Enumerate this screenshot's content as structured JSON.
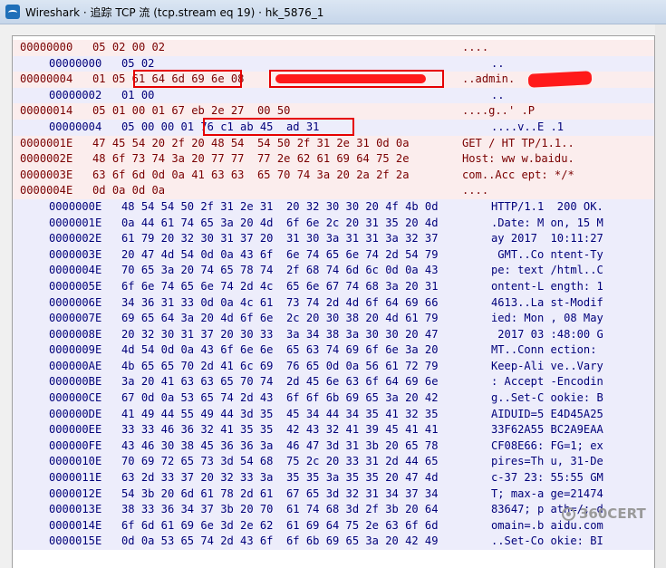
{
  "window": {
    "title": "Wireshark · 追踪 TCP 流 (tcp.stream eq 19) · hk_5876_1"
  },
  "watermark": {
    "text": "360CERT"
  },
  "rows": [
    {
      "dir": "c",
      "off": "00000000",
      "hex": "05 02 00 02",
      "asc": "...."
    },
    {
      "dir": "s",
      "off": "00000000",
      "hex": "05 02",
      "asc": ".."
    },
    {
      "dir": "c",
      "off": "00000004",
      "hex": "01 05 61 64 6d 69 6e 08",
      "asc": "..admin."
    },
    {
      "dir": "s",
      "off": "00000002",
      "hex": "01 00",
      "asc": ".."
    },
    {
      "dir": "c",
      "off": "00000014",
      "hex": "05 01 00 01 67 eb 2e 27  00 50",
      "asc": "....g..' .P"
    },
    {
      "dir": "s",
      "off": "00000004",
      "hex": "05 00 00 01 76 c1 ab 45  ad 31",
      "asc": "....v..E .1"
    },
    {
      "dir": "c",
      "off": "0000001E",
      "hex": "47 45 54 20 2f 20 48 54  54 50 2f 31 2e 31 0d 0a",
      "asc": "GET / HT TP/1.1.."
    },
    {
      "dir": "c",
      "off": "0000002E",
      "hex": "48 6f 73 74 3a 20 77 77  77 2e 62 61 69 64 75 2e",
      "asc": "Host: ww w.baidu."
    },
    {
      "dir": "c",
      "off": "0000003E",
      "hex": "63 6f 6d 0d 0a 41 63 63  65 70 74 3a 20 2a 2f 2a",
      "asc": "com..Acc ept: */*"
    },
    {
      "dir": "c",
      "off": "0000004E",
      "hex": "0d 0a 0d 0a",
      "asc": "...."
    },
    {
      "dir": "s",
      "off": "0000000E",
      "hex": "48 54 54 50 2f 31 2e 31  20 32 30 30 20 4f 4b 0d",
      "asc": "HTTP/1.1  200 OK."
    },
    {
      "dir": "s",
      "off": "0000001E",
      "hex": "0a 44 61 74 65 3a 20 4d  6f 6e 2c 20 31 35 20 4d",
      "asc": ".Date: M on, 15 M"
    },
    {
      "dir": "s",
      "off": "0000002E",
      "hex": "61 79 20 32 30 31 37 20  31 30 3a 31 31 3a 32 37",
      "asc": "ay 2017  10:11:27"
    },
    {
      "dir": "s",
      "off": "0000003E",
      "hex": "20 47 4d 54 0d 0a 43 6f  6e 74 65 6e 74 2d 54 79",
      "asc": " GMT..Co ntent-Ty"
    },
    {
      "dir": "s",
      "off": "0000004E",
      "hex": "70 65 3a 20 74 65 78 74  2f 68 74 6d 6c 0d 0a 43",
      "asc": "pe: text /html..C"
    },
    {
      "dir": "s",
      "off": "0000005E",
      "hex": "6f 6e 74 65 6e 74 2d 4c  65 6e 67 74 68 3a 20 31",
      "asc": "ontent-L ength: 1"
    },
    {
      "dir": "s",
      "off": "0000006E",
      "hex": "34 36 31 33 0d 0a 4c 61  73 74 2d 4d 6f 64 69 66",
      "asc": "4613..La st-Modif"
    },
    {
      "dir": "s",
      "off": "0000007E",
      "hex": "69 65 64 3a 20 4d 6f 6e  2c 20 30 38 20 4d 61 79",
      "asc": "ied: Mon , 08 May"
    },
    {
      "dir": "s",
      "off": "0000008E",
      "hex": "20 32 30 31 37 20 30 33  3a 34 38 3a 30 30 20 47",
      "asc": " 2017 03 :48:00 G"
    },
    {
      "dir": "s",
      "off": "0000009E",
      "hex": "4d 54 0d 0a 43 6f 6e 6e  65 63 74 69 6f 6e 3a 20",
      "asc": "MT..Conn ection: "
    },
    {
      "dir": "s",
      "off": "000000AE",
      "hex": "4b 65 65 70 2d 41 6c 69  76 65 0d 0a 56 61 72 79",
      "asc": "Keep-Ali ve..Vary"
    },
    {
      "dir": "s",
      "off": "000000BE",
      "hex": "3a 20 41 63 63 65 70 74  2d 45 6e 63 6f 64 69 6e",
      "asc": ": Accept -Encodin"
    },
    {
      "dir": "s",
      "off": "000000CE",
      "hex": "67 0d 0a 53 65 74 2d 43  6f 6f 6b 69 65 3a 20 42",
      "asc": "g..Set-C ookie: B"
    },
    {
      "dir": "s",
      "off": "000000DE",
      "hex": "41 49 44 55 49 44 3d 35  45 34 44 34 35 41 32 35",
      "asc": "AIDUID=5 E4D45A25"
    },
    {
      "dir": "s",
      "off": "000000EE",
      "hex": "33 33 46 36 32 41 35 35  42 43 32 41 39 45 41 41",
      "asc": "33F62A55 BC2A9EAA"
    },
    {
      "dir": "s",
      "off": "000000FE",
      "hex": "43 46 30 38 45 36 36 3a  46 47 3d 31 3b 20 65 78",
      "asc": "CF08E66: FG=1; ex"
    },
    {
      "dir": "s",
      "off": "0000010E",
      "hex": "70 69 72 65 73 3d 54 68  75 2c 20 33 31 2d 44 65",
      "asc": "pires=Th u, 31-De"
    },
    {
      "dir": "s",
      "off": "0000011E",
      "hex": "63 2d 33 37 20 32 33 3a  35 35 3a 35 35 20 47 4d",
      "asc": "c-37 23: 55:55 GM"
    },
    {
      "dir": "s",
      "off": "0000012E",
      "hex": "54 3b 20 6d 61 78 2d 61  67 65 3d 32 31 34 37 34",
      "asc": "T; max-a ge=21474"
    },
    {
      "dir": "s",
      "off": "0000013E",
      "hex": "38 33 36 34 37 3b 20 70  61 74 68 3d 2f 3b 20 64",
      "asc": "83647; p ath=/; d"
    },
    {
      "dir": "s",
      "off": "0000014E",
      "hex": "6f 6d 61 69 6e 3d 2e 62  61 69 64 75 2e 63 6f 6d",
      "asc": "omain=.b aidu.com"
    },
    {
      "dir": "s",
      "off": "0000015E",
      "hex": "0d 0a 53 65 74 2d 43 6f  6f 6b 69 65 3a 20 42 49",
      "asc": "..Set-Co okie: BI"
    }
  ]
}
